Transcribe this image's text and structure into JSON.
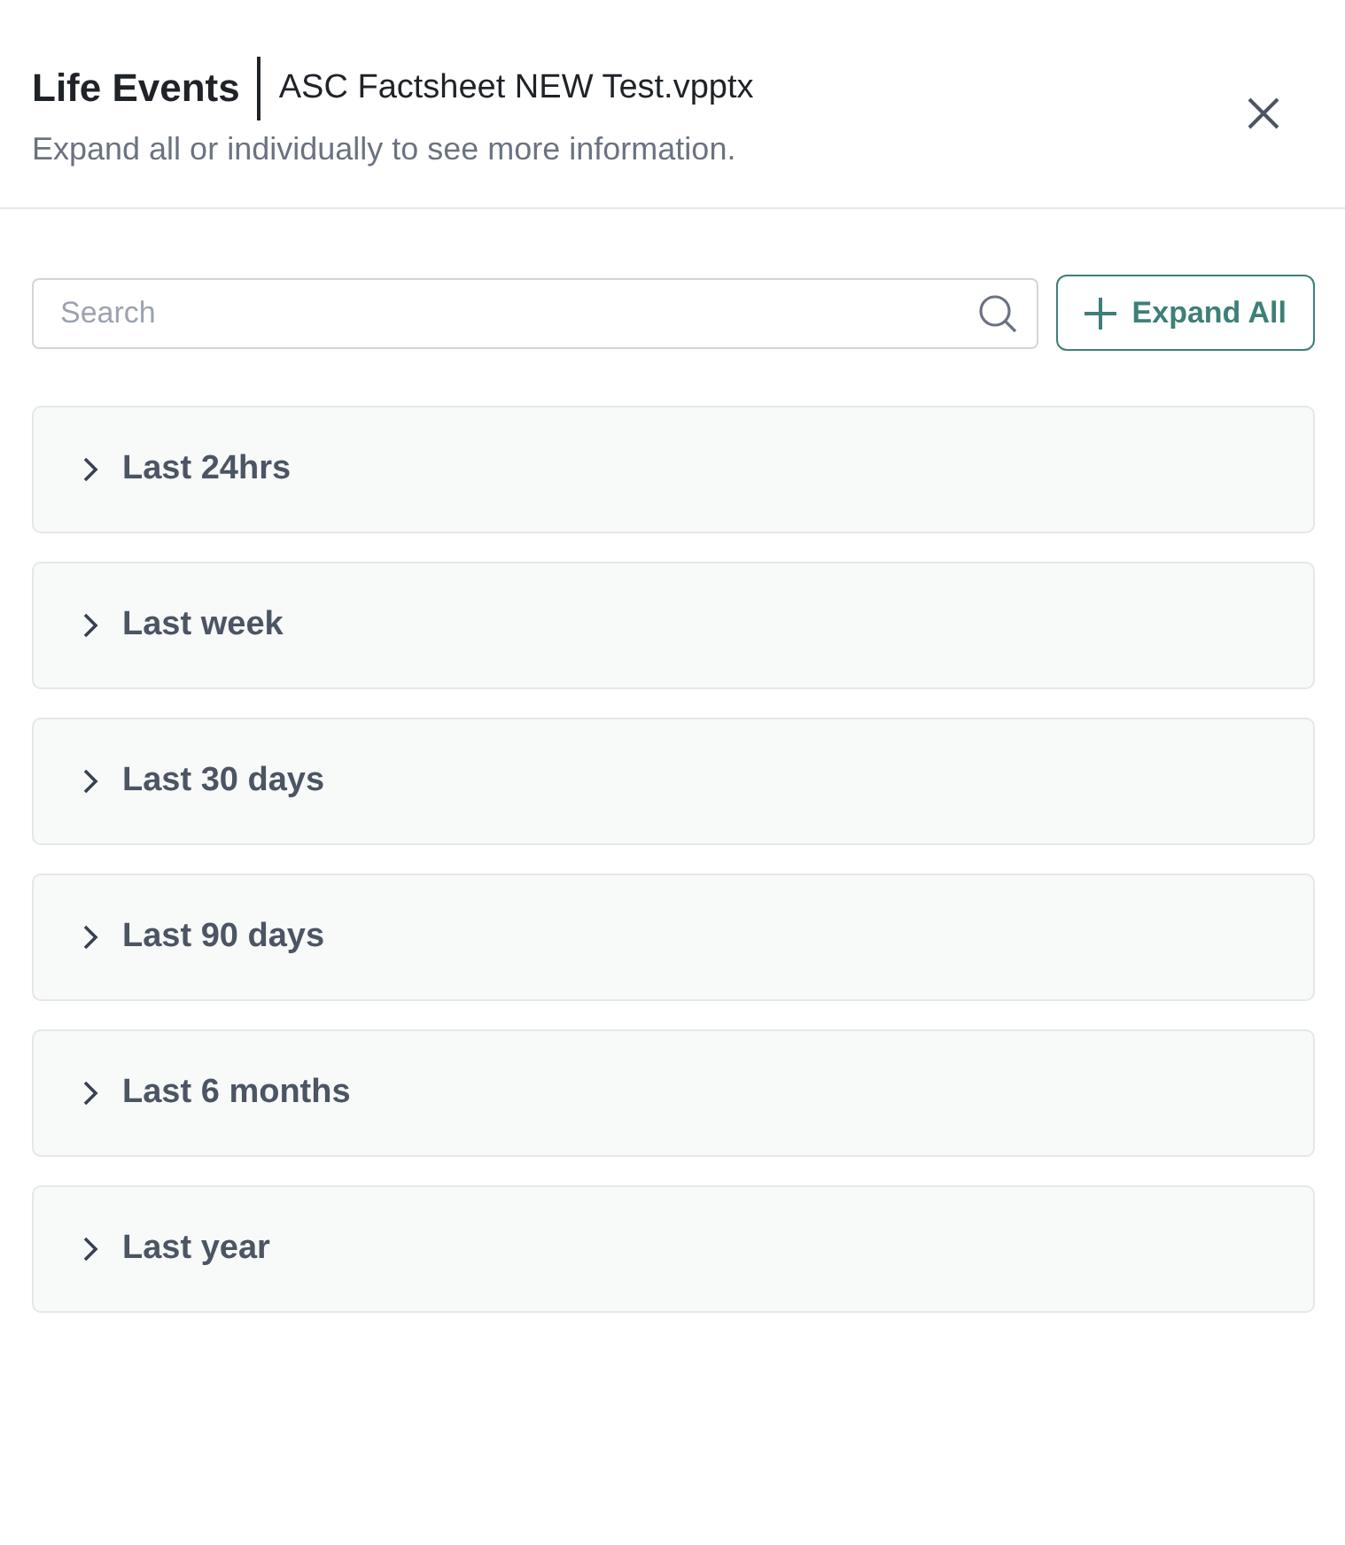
{
  "header": {
    "title": "Life Events",
    "file_name": "ASC Factsheet NEW Test.vpptx",
    "subtitle": "Expand all or individually to see more information."
  },
  "search": {
    "placeholder": "Search"
  },
  "expand_button": {
    "label": "Expand All"
  },
  "sections": [
    {
      "label": "Last 24hrs",
      "expanded": false
    },
    {
      "label": "Last week",
      "expanded": false
    },
    {
      "label": "Last 30 days",
      "expanded": false
    },
    {
      "label": "Last 90 days",
      "expanded": false
    },
    {
      "label": "Last 6 months",
      "expanded": false
    },
    {
      "label": "Last year",
      "expanded": false
    }
  ]
}
